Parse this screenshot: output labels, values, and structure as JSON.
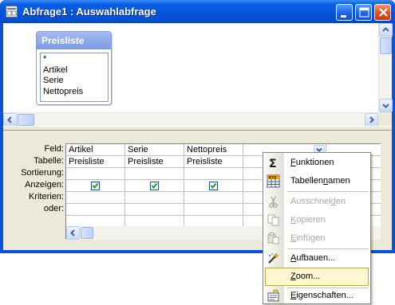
{
  "window": {
    "title": "Abfrage1 : Auswahlabfrage",
    "buttons": [
      "minimize",
      "maximize",
      "close"
    ]
  },
  "table_box": {
    "title": "Preisliste",
    "fields": [
      "*",
      "Artikel",
      "Serie",
      "Nettopreis"
    ]
  },
  "grid": {
    "row_labels": [
      "Feld:",
      "Tabelle:",
      "Sortierung:",
      "Anzeigen:",
      "Kriterien:",
      "oder:"
    ],
    "columns": [
      {
        "feld": "Artikel",
        "tabelle": "Preisliste",
        "anzeigen": true
      },
      {
        "feld": "Serie",
        "tabelle": "Preisliste",
        "anzeigen": true
      },
      {
        "feld": "Nettopreis",
        "tabelle": "Preisliste",
        "anzeigen": true
      },
      {
        "feld": "",
        "tabelle": "",
        "anzeigen": false
      }
    ]
  },
  "context_menu": {
    "items": [
      {
        "label_pre": "",
        "label_key": "F",
        "label_post": "unktionen",
        "icon": "sigma-icon",
        "disabled": false
      },
      {
        "label_pre": "Tabellen",
        "label_key": "n",
        "label_post": "amen",
        "icon": "table-names-icon",
        "disabled": false
      },
      {
        "label_pre": "Ausschnei",
        "label_key": "d",
        "label_post": "en",
        "icon": "cut-icon",
        "disabled": true
      },
      {
        "label_pre": "",
        "label_key": "K",
        "label_post": "opieren",
        "icon": "copy-icon",
        "disabled": true
      },
      {
        "label_pre": "",
        "label_key": "E",
        "label_post": "infügen",
        "icon": "paste-icon",
        "disabled": true
      },
      {
        "label_pre": "",
        "label_key": "A",
        "label_post": "ufbauen...",
        "icon": "build-wand-icon",
        "disabled": false
      },
      {
        "label_pre": "",
        "label_key": "Z",
        "label_post": "oom...",
        "icon": "",
        "disabled": false,
        "hover": true
      },
      {
        "label_pre": "",
        "label_key": "E",
        "label_post": "igenschaften...",
        "icon": "properties-icon",
        "disabled": false
      }
    ]
  },
  "colors": {
    "titlebar": "#0554d8",
    "menu_hover": "#fff7cf",
    "menu_hover_border": "#c0a24b",
    "checkbox_check": "#21a121"
  }
}
